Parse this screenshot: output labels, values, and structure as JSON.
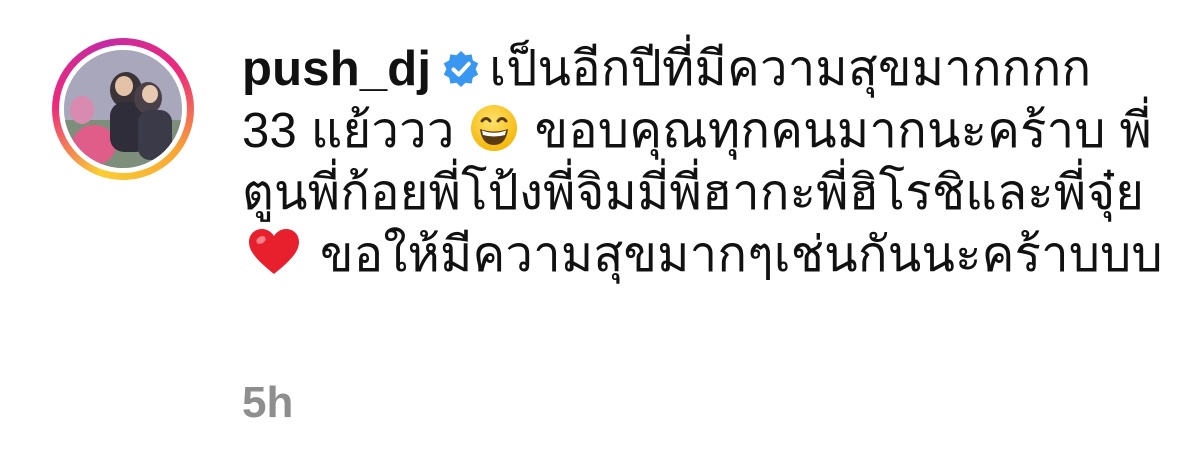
{
  "comment": {
    "avatar_icon": "avatar",
    "username": "push_dj",
    "verified_icon": "verified-badge-icon",
    "lines": [
      "เป็นอีกปีที่มีความสุขมากกกก",
      "33 แย้ววว",
      "ขอบคุณทุกคนมากนะคร้าบ พี่",
      "ตูนพี่ก้อยพี่โป้งพี่จิมมี่พี่ฮากะพี่ฮิโรชิและพี่จุ๋ย",
      "ขอให้มีความสุขมากๆเช่นกันนะคร้าบบบ"
    ],
    "emojis": [
      "grinning-face-emoji",
      "red-heart-emoji"
    ],
    "timestamp": "5h"
  },
  "colors": {
    "text": "#111111",
    "muted": "#8e8e8e",
    "verified": "#3897f0"
  }
}
